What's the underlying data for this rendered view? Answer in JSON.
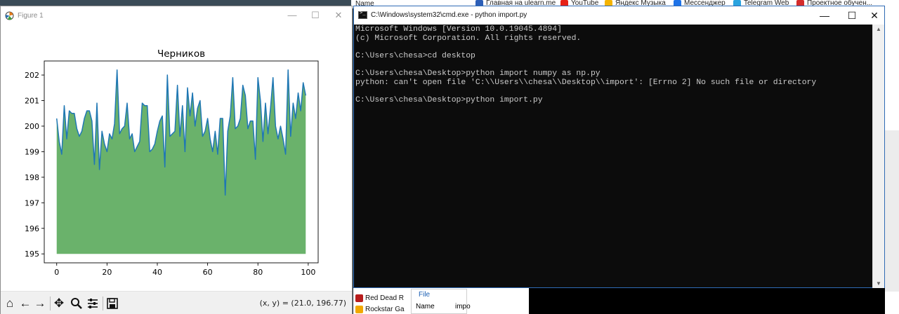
{
  "browser_bookmarks": [
    {
      "label": "Главная на ulearn.me",
      "icon": "ulearn-icon",
      "color": "#2c5fb8"
    },
    {
      "label": "YouTube",
      "icon": "youtube-icon",
      "color": "#e62117"
    },
    {
      "label": "Яндекс Музыка",
      "icon": "yandex-music-icon",
      "color": "#f5b400"
    },
    {
      "label": "Мессенджер",
      "icon": "messenger-icon",
      "color": "#1e73e8"
    },
    {
      "label": "Telegram Web",
      "icon": "telegram-icon",
      "color": "#2aa3df"
    },
    {
      "label": "Проектное обучен...",
      "icon": "project-icon",
      "color": "#d42c2c"
    }
  ],
  "background": {
    "name_label": "Name",
    "taskbar_items": [
      {
        "label": "Red Dead R",
        "icon": "red-dead-icon",
        "color": "#b71c1c"
      },
      {
        "label": "Rockstar Ga",
        "icon": "rockstar-icon",
        "color": "#f1a800"
      }
    ],
    "file_panel": {
      "tab": "File",
      "name_label": "Name",
      "name_value": "impo"
    }
  },
  "figure_window": {
    "title": "Figure 1",
    "toolbar": {
      "home": "home-icon",
      "back": "back-arrow-icon",
      "forward": "forward-arrow-icon",
      "pan": "pan-icon",
      "zoom": "zoom-icon",
      "configure": "configure-subplots-icon",
      "save": "save-icon"
    },
    "coords_readout": "(x, y) = (21.0, 196.77)"
  },
  "cmd_window": {
    "title": "C:\\Windows\\system32\\cmd.exe - python  import.py",
    "lines": [
      "Microsoft Windows [Version 10.0.19045.4894]",
      "(c) Microsoft Corporation. All rights reserved.",
      "",
      "C:\\Users\\chesa>cd desktop",
      "",
      "C:\\Users\\chesa\\Desktop>python import numpy as np.py",
      "python: can't open file 'C:\\\\Users\\\\chesa\\\\Desktop\\\\import': [Errno 2] No such file or directory",
      "",
      "C:\\Users\\chesa\\Desktop>python import.py"
    ]
  },
  "chart_data": {
    "type": "area",
    "title": "Черников",
    "xlabel": "",
    "ylabel": "",
    "xlim": [
      -4.95,
      103.95
    ],
    "ylim": [
      194.65,
      202.55
    ],
    "xticks": [
      0,
      20,
      40,
      60,
      80,
      100
    ],
    "yticks": [
      195,
      196,
      197,
      198,
      199,
      200,
      201,
      202
    ],
    "fill_baseline": 195,
    "line_color": "#1f77b4",
    "fill_color": "#6ab26b",
    "x": [
      0,
      1,
      2,
      3,
      4,
      5,
      6,
      7,
      8,
      9,
      10,
      11,
      12,
      13,
      14,
      15,
      16,
      17,
      18,
      19,
      20,
      21,
      22,
      23,
      24,
      25,
      26,
      27,
      28,
      29,
      30,
      31,
      32,
      33,
      34,
      35,
      36,
      37,
      38,
      39,
      40,
      41,
      42,
      43,
      44,
      45,
      46,
      47,
      48,
      49,
      50,
      51,
      52,
      53,
      54,
      55,
      56,
      57,
      58,
      59,
      60,
      61,
      62,
      63,
      64,
      65,
      66,
      67,
      68,
      69,
      70,
      71,
      72,
      73,
      74,
      75,
      76,
      77,
      78,
      79,
      80,
      81,
      82,
      83,
      84,
      85,
      86,
      87,
      88,
      89,
      90,
      91,
      92,
      93,
      94,
      95,
      96,
      97,
      98,
      99
    ],
    "y": [
      200.3,
      199.4,
      198.9,
      200.8,
      199.5,
      200.6,
      200.5,
      200.5,
      199.9,
      199.6,
      199.8,
      200.3,
      200.6,
      200.6,
      200.2,
      198.5,
      200.9,
      198.3,
      199.8,
      199.3,
      199.0,
      199.7,
      199.5,
      200.1,
      202.2,
      199.7,
      199.9,
      200.0,
      200.9,
      199.5,
      199.7,
      199.0,
      199.2,
      199.4,
      200.9,
      200.8,
      200.8,
      199.0,
      199.1,
      199.3,
      199.8,
      200.2,
      200.4,
      198.4,
      202.0,
      199.6,
      199.7,
      199.8,
      201.6,
      199.6,
      200.8,
      199.0,
      201.5,
      200.4,
      201.3,
      200.0,
      200.7,
      201.0,
      199.6,
      199.8,
      200.3,
      199.5,
      199.0,
      199.8,
      198.9,
      200.3,
      200.3,
      197.3,
      199.8,
      200.4,
      201.9,
      199.9,
      200.0,
      200.3,
      201.6,
      201.2,
      199.9,
      200.2,
      200.2,
      198.7,
      201.9,
      201.0,
      199.4,
      200.9,
      199.7,
      200.7,
      201.9,
      200.0,
      199.5,
      200.0,
      199.5,
      198.9,
      202.2,
      199.6,
      200.9,
      200.3,
      201.3,
      200.6,
      201.7,
      201.2
    ]
  }
}
